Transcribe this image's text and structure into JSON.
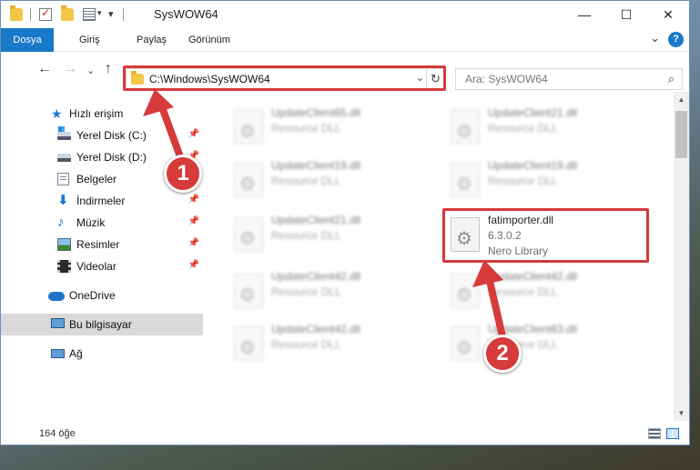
{
  "window": {
    "title": "SysWOW64",
    "minimize_glyph": "—",
    "maximize_glyph": "☐",
    "close_glyph": "✕"
  },
  "ribbon": {
    "tabs": [
      {
        "label": "Dosya",
        "active": true
      },
      {
        "label": "Giriş"
      },
      {
        "label": "Paylaş"
      },
      {
        "label": "Görünüm"
      }
    ],
    "collapse_glyph": "⌄",
    "help_glyph": "?"
  },
  "navigation": {
    "back_glyph": "←",
    "forward_glyph": "→",
    "recent_glyph": "⌄",
    "up_glyph": "↑",
    "address": "C:\\Windows\\SysWOW64",
    "address_dropdown_glyph": "⌄",
    "refresh_glyph": "↻",
    "search_placeholder": "Ara: SysWOW64",
    "search_glyph": "⌕"
  },
  "sidebar": {
    "items": [
      {
        "label": "Hızlı erişim",
        "icon": "star-icon"
      },
      {
        "label": "Yerel Disk (C:)",
        "icon": "drive-icon",
        "pinned": true
      },
      {
        "label": "Yerel Disk (D:)",
        "icon": "drive-icon",
        "pinned": true
      },
      {
        "label": "Belgeler",
        "icon": "documents-icon",
        "pinned": true
      },
      {
        "label": "İndirmeler",
        "icon": "download-icon",
        "pinned": true
      },
      {
        "label": "Müzik",
        "icon": "music-icon",
        "pinned": true
      },
      {
        "label": "Resimler",
        "icon": "pictures-icon",
        "pinned": true
      },
      {
        "label": "Videolar",
        "icon": "videos-icon",
        "pinned": true
      },
      {
        "label": "OneDrive",
        "icon": "cloud-icon"
      },
      {
        "label": "Bu bilgisayar",
        "icon": "computer-icon",
        "selected": true
      },
      {
        "label": "Ağ",
        "icon": "network-icon"
      }
    ],
    "pin_glyph": "📌"
  },
  "files": [
    {
      "name": "UpdateClient65.dll",
      "type": "Resource DLL"
    },
    {
      "name": "UpdateClient21.dll",
      "type": "Resource DLL"
    },
    {
      "name": "UpdateClient19.dll",
      "type": "Resource DLL"
    },
    {
      "name": "UpdateClient19.dll",
      "type": "Resource DLL"
    },
    {
      "name": "UpdateClient21.dll",
      "type": "Resource DLL"
    },
    {
      "name": "fatimporter.dll",
      "version": "6.3.0.2",
      "type": "Nero Library",
      "highlighted": true
    },
    {
      "name": "UpdateClient42.dll",
      "type": "Resource DLL"
    },
    {
      "name": "UpdateClient42.dll",
      "type": "Resource DLL"
    },
    {
      "name": "UpdateClient42.dll",
      "type": "Resource DLL"
    },
    {
      "name": "UpdateClient63.dll",
      "type": "Resource DLL"
    }
  ],
  "scrollbar": {
    "up_glyph": "▲",
    "down_glyph": "▼"
  },
  "status": {
    "item_count": "164 öğe"
  },
  "annotations": {
    "step1_label": "1",
    "step2_label": "2",
    "color": "#d63a3a"
  },
  "colors": {
    "accent": "#1979ca",
    "selection": "#d9d9d9"
  }
}
